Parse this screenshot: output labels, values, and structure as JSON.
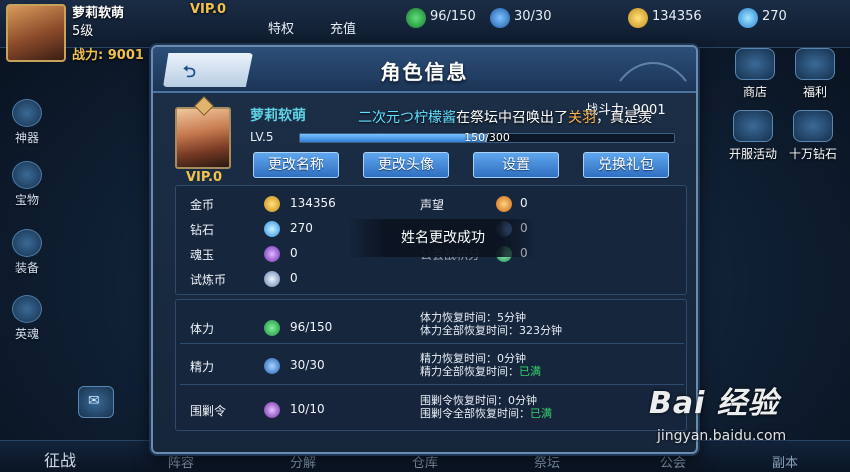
{
  "top_bar": {
    "player_name": "萝莉软萌",
    "level": "5级",
    "vip": "VIP.0",
    "power_label": "战力: 9001",
    "tabs": [
      "特权",
      "充值"
    ],
    "resources": [
      "96/150",
      "30/30",
      "134356",
      "270"
    ]
  },
  "side_menu": [
    "神器",
    "宝物",
    "装备",
    "英魂"
  ],
  "right_menu": [
    "商店",
    "福利",
    "开服活动",
    "十万钻石"
  ],
  "bottom_tabs": [
    "征战",
    "阵容",
    "分解",
    "仓库",
    "祭坛",
    "公会",
    "副本"
  ],
  "dialog": {
    "title": "角色信息",
    "name": "萝莉软萌",
    "vip": "VIP.0",
    "combat_power": "战斗力: 9001",
    "marquee": {
      "part1": "二次元つ柠檬酱",
      "part2": "在祭坛中召唤出了",
      "part3": "关羽",
      "part4": "，真是羡"
    },
    "level": "LV.5",
    "xp_text": "150/300",
    "xp_fraction": 0.5,
    "buttons": [
      "更改名称",
      "更改头像",
      "设置",
      "兑换礼包"
    ],
    "currency": {
      "gold_label": "金币",
      "gold": "134356",
      "diamond_label": "钻石",
      "diamond": "270",
      "soul_label": "魂玉",
      "soul": "0",
      "trial_label": "试炼币",
      "trial": "0",
      "prestige_label": "声望",
      "prestige": "0",
      "honor_label": "荣誉",
      "honor": "0",
      "guild_label": "公会战积分",
      "guild": "0"
    },
    "toast": "姓名更改成功",
    "stamina": {
      "label": "体力",
      "value": "96/150",
      "line1": "体力恢复时间：5分钟",
      "line2_prefix": "体力全部恢复时间：",
      "line2_value": "323分钟"
    },
    "energy": {
      "label": "精力",
      "value": "30/30",
      "line1": "精力恢复时间：0分钟",
      "line2_prefix": "精力全部恢复时间：",
      "line2_value": "已满"
    },
    "siege": {
      "label": "围剿令",
      "value": "10/10",
      "line1": "围剿令恢复时间：0分钟",
      "line2_prefix": "围剿令全部恢复时间：",
      "line2_value": "已满"
    }
  },
  "watermark": {
    "brand": "Bai 经验",
    "url": "jingyan.baidu.com"
  },
  "colors": {
    "gold": "#f2c14e",
    "name": "#5fd2e6",
    "ok": "#34d36b",
    "button": "#3f86d8"
  }
}
